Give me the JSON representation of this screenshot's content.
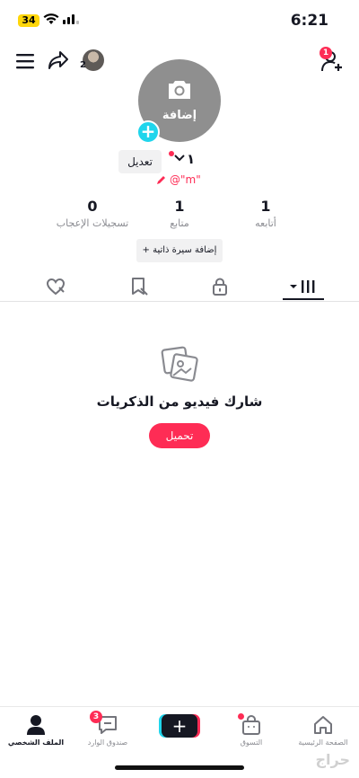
{
  "status_bar": {
    "time": "6:21",
    "battery": "34"
  },
  "top_bar": {
    "followers_mini_count": "2",
    "notification_count": "1"
  },
  "profile": {
    "avatar_label": "إضافة",
    "name": "١",
    "edit_label": "تعديل",
    "handle": "@\"m\"",
    "stats": [
      {
        "value": "1",
        "label": "أتابعه"
      },
      {
        "value": "1",
        "label": "متابع"
      },
      {
        "value": "0",
        "label": "تسجيلات الإعجاب"
      }
    ],
    "bio_button": "+ إضافة سيرة ذاتية"
  },
  "tabs": {
    "icons": [
      "videos-grid-icon",
      "lock-icon",
      "repost-icon",
      "liked-heart-icon"
    ]
  },
  "empty_state": {
    "title": "شارك فيديو من الذكريات",
    "upload_label": "تحميل"
  },
  "bottom_nav": {
    "items": [
      {
        "label": "الملف الشخصي"
      },
      {
        "label": "صندوق الوارد",
        "badge": "3"
      },
      {
        "label": ""
      },
      {
        "label": "التسوق"
      },
      {
        "label": "الصفحة الرئيسية"
      }
    ]
  },
  "watermark": "حراج",
  "colors": {
    "accent": "#fe2c55",
    "cyan": "#20d5ec",
    "text": "#161823"
  }
}
